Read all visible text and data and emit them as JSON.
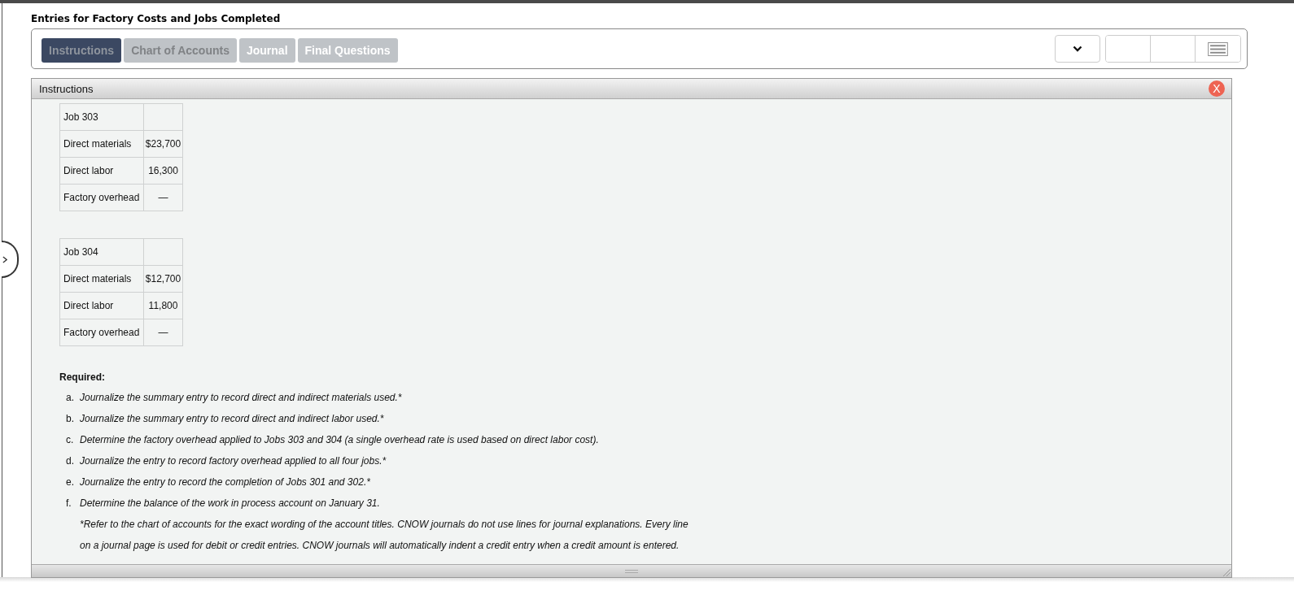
{
  "title": "Entries for Factory Costs and Jobs Completed",
  "tabs": [
    {
      "label": "Instructions",
      "selected": true,
      "dimmed": true
    },
    {
      "label": "Chart of Accounts",
      "selected": false,
      "dimmed": true
    },
    {
      "label": "Journal",
      "selected": false,
      "dimmed": false
    },
    {
      "label": "Final Questions",
      "selected": false,
      "dimmed": false
    }
  ],
  "panel": {
    "title": "Instructions",
    "close_label": "X",
    "tables": [
      {
        "heading": "Job 303",
        "rows": [
          {
            "label": "Direct materials",
            "amount": "$23,700"
          },
          {
            "label": "Direct labor",
            "amount": "16,300"
          },
          {
            "label": "Factory overhead",
            "amount": "—"
          }
        ]
      },
      {
        "heading": "Job 304",
        "rows": [
          {
            "label": "Direct materials",
            "amount": "$12,700"
          },
          {
            "label": "Direct labor",
            "amount": "11,800"
          },
          {
            "label": "Factory overhead",
            "amount": "—"
          }
        ]
      }
    ],
    "required": {
      "heading": "Required:",
      "items": [
        {
          "marker": "a.",
          "text": "Journalize the summary entry to record direct and indirect materials used.*"
        },
        {
          "marker": "b.",
          "text": "Journalize the summary entry to record direct and indirect labor used.*"
        },
        {
          "marker": "c.",
          "text": "Determine the factory overhead applied to Jobs 303 and 304 (a single overhead rate is used based on direct labor cost)."
        },
        {
          "marker": "d.",
          "text": "Journalize the entry to record factory overhead applied to all four jobs.*"
        },
        {
          "marker": "e.",
          "text": "Journalize the entry to record the completion of Jobs 301 and 302.*"
        },
        {
          "marker": "f.",
          "text": "Determine the balance of the work in process account on January 31."
        }
      ],
      "note": "*Refer to the chart of accounts for the exact wording of the account titles. CNOW journals do not use lines for journal explanations. Every line on a journal page is used for debit or credit entries. CNOW journals will automatically indent a credit entry when a credit amount is entered."
    }
  }
}
